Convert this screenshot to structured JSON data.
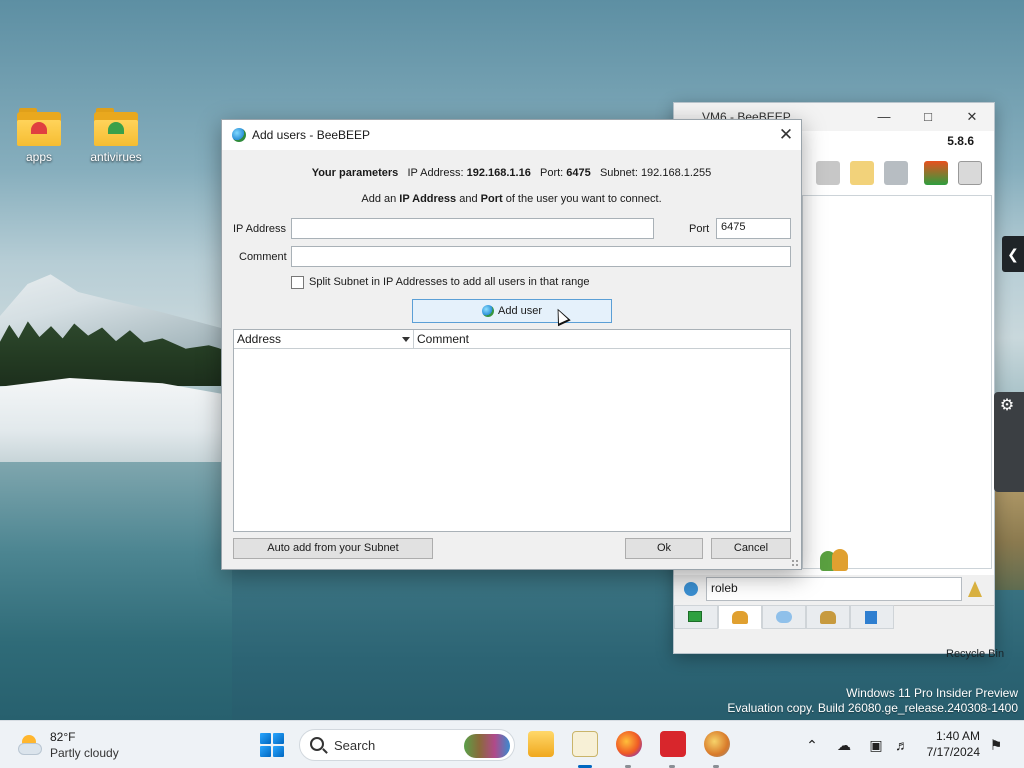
{
  "desktop": {
    "icons": [
      {
        "label": "apps"
      },
      {
        "label": "antivirues"
      }
    ],
    "recycle_bin": "Recycle Bin",
    "watermark": {
      "line1": "Windows 11 Pro Insider Preview",
      "line2": "Evaluation copy. Build 26080.ge_release.240308-1400"
    }
  },
  "main_window": {
    "title": "VM6 - BeeBEEP",
    "version": "5.8.6",
    "search_value": "roleb",
    "toolbar_icons": [
      "folder-icon",
      "edit-note-icon",
      "tools-icon",
      "update-icon",
      "bucket-icon"
    ],
    "bottom_tabs": [
      "computer-icon",
      "users-icon",
      "chat-icon",
      "groups-icon",
      "share-icon"
    ]
  },
  "dialog": {
    "title": "Add users - BeeBEEP",
    "params": {
      "label": "Your parameters",
      "ip_label": "IP Address:",
      "ip_value": "192.168.1.16",
      "port_label": "Port:",
      "port_value": "6475",
      "subnet_label": "Subnet:",
      "subnet_value": "192.168.1.255"
    },
    "hint": {
      "pre": "Add an",
      "ip": "IP Address",
      "and": "and",
      "port": "Port",
      "post": "of the user you want to connect."
    },
    "ip_label": "IP Address",
    "ip_value": "",
    "port_label": "Port",
    "port_value": "6475",
    "comment_label": "Comment",
    "comment_value": "",
    "split_subnet_label": "Split Subnet in IP Addresses to add all users in that range",
    "add_user_label": "Add user",
    "table": {
      "columns": [
        "Address",
        "Comment"
      ],
      "rows": []
    },
    "auto_add_label": "Auto add from your Subnet",
    "ok_label": "Ok",
    "cancel_label": "Cancel"
  },
  "taskbar": {
    "weather_temp": "82°F",
    "weather_desc": "Partly cloudy",
    "search_placeholder": "Search",
    "time": "1:40 AM",
    "date": "7/17/2024"
  }
}
